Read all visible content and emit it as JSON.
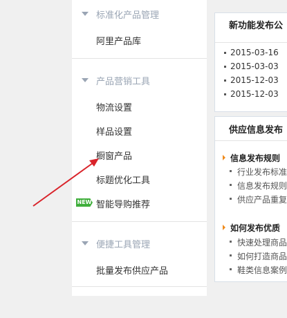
{
  "sidebar": {
    "sections": [
      {
        "header": "标准化产品管理",
        "items": [
          "阿里产品库"
        ]
      },
      {
        "header": "产品营销工具",
        "items": [
          "物流设置",
          "样品设置",
          "橱窗产品",
          "标题优化工具",
          "智能导购推荐"
        ]
      },
      {
        "header": "便捷工具管理",
        "items": [
          "批量发布供应产品"
        ]
      }
    ],
    "new_badge": "NEW"
  },
  "right": {
    "panel1": {
      "title": "新功能发布公",
      "dates": [
        "2015-03-16",
        "2015-03-03",
        "2015-12-03",
        "2015-12-03"
      ]
    },
    "panel2": {
      "title": "供应信息发布",
      "groups": [
        {
          "heading": "信息发布规则",
          "links": [
            "行业发布标准",
            "信息发布规则",
            "供应产品重复"
          ]
        },
        {
          "heading": "如何发布优质",
          "links": [
            "快速处理商品",
            "如何打造商品",
            "鞋类信息案例"
          ]
        }
      ]
    }
  },
  "colors": {
    "arrow": "#d9232a",
    "badge": "#3fae3b",
    "section_header": "#9aa5b4"
  }
}
